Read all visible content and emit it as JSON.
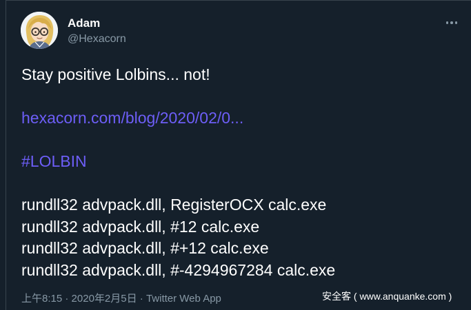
{
  "user": {
    "name": "Adam",
    "handle": "@Hexacorn"
  },
  "tweet": {
    "line1": "Stay positive Lolbins... not!",
    "link": "hexacorn.com/blog/2020/02/0...",
    "hashtag": "#LOLBIN",
    "commands": [
      "rundll32 advpack.dll, RegisterOCX calc.exe",
      "rundll32 advpack.dll, #12 calc.exe",
      "rundll32 advpack.dll, #+12 calc.exe",
      "rundll32 advpack.dll, #-4294967284 calc.exe"
    ]
  },
  "meta": {
    "time": "上午8:15",
    "date": "2020年2月5日",
    "separator": "·",
    "client": "Twitter Web App"
  },
  "watermark": "安全客 ( www.anquanke.com )",
  "colors": {
    "background": "#15202b",
    "link": "#6d5ef7",
    "muted": "#8899a6",
    "border": "#38444d"
  }
}
